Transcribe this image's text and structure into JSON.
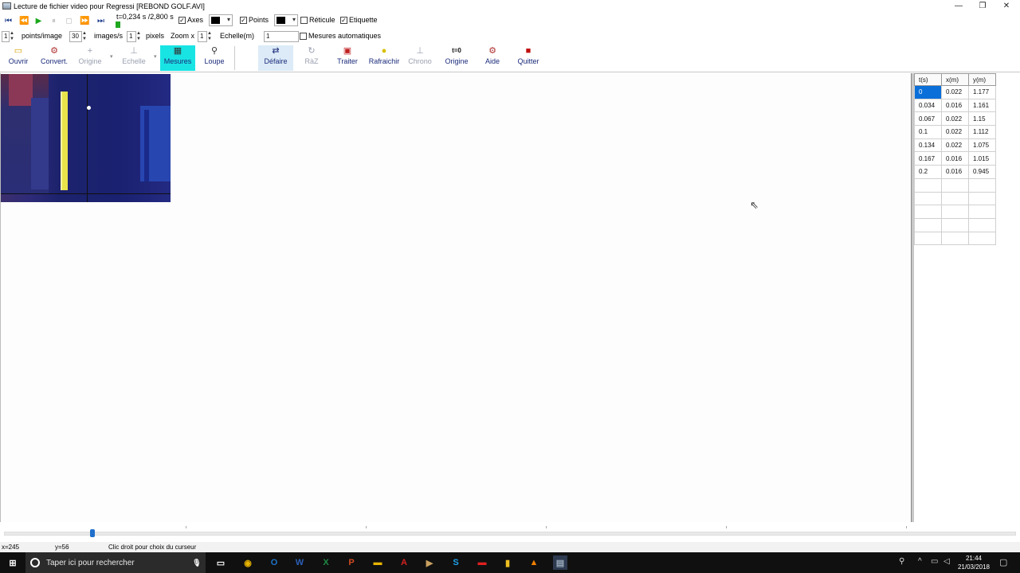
{
  "window": {
    "title": "Lecture de fichier video pour Regressi [REBOND GOLF.AVI]",
    "controls": [
      "minimize",
      "maximize",
      "close"
    ]
  },
  "playback": {
    "time_readout": "t=0,234 s /2,800 s",
    "time_progress": 0.0836,
    "axes_label": "Axes",
    "axes_checked": true,
    "points_label": "Points",
    "points_checked": true,
    "reticule_label": "Réticule",
    "reticule_checked": false,
    "etiquette_label": "Etiquette",
    "etiquette_checked": true,
    "axes_color": "#000000",
    "points_color": "#000000"
  },
  "params": {
    "points_per_image_value": "1",
    "points_per_image_label": "points/image",
    "images_per_s_value": "30",
    "images_per_s_label": "images/s",
    "pixels_value": "1",
    "pixels_label": "pixels",
    "zoom_label": "Zoom x",
    "zoom_value": "1",
    "echelle_label": "Echelle(m)",
    "echelle_value": "1",
    "mesures_auto_label": "Mesures automatiques",
    "mesures_auto_checked": false
  },
  "toolbar": {
    "ouvrir": "Ouvrir",
    "convert": "Convert.",
    "origine1": "Origine",
    "echelle": "Echelle",
    "mesures": "Mesures",
    "loupe": "Loupe",
    "defaire": "Défaire",
    "raz": "RàZ",
    "traiter": "Traiter",
    "rafraichir": "Rafraichir",
    "chrono": "Chrono",
    "chrono_icon_text": "t=0",
    "origine2": "Origine",
    "aide": "Aide",
    "quitter": "Quitter"
  },
  "table": {
    "headers": [
      "t(s)",
      "x(m)",
      "y(m)"
    ],
    "rows": [
      [
        "0",
        "0.022",
        "1.177"
      ],
      [
        "0.034",
        "0.016",
        "1.161"
      ],
      [
        "0.067",
        "0.022",
        "1.15"
      ],
      [
        "0.1",
        "0.022",
        "1.112"
      ],
      [
        "0.134",
        "0.022",
        "1.075"
      ],
      [
        "0.167",
        "0.016",
        "1.015"
      ],
      [
        "0.2",
        "0.016",
        "0.945"
      ],
      [
        "",
        "",
        ""
      ],
      [
        "",
        "",
        ""
      ],
      [
        "",
        "",
        ""
      ],
      [
        "",
        "",
        ""
      ],
      [
        "",
        "",
        ""
      ]
    ]
  },
  "frame_slider": {
    "position": 0.085
  },
  "status": {
    "x": "x=245",
    "y": "y=56",
    "hint": "Clic droit pour choix du curseur"
  },
  "taskbar": {
    "search_placeholder": "Taper ici pour rechercher",
    "time": "21:44",
    "date": "21/03/2018"
  }
}
